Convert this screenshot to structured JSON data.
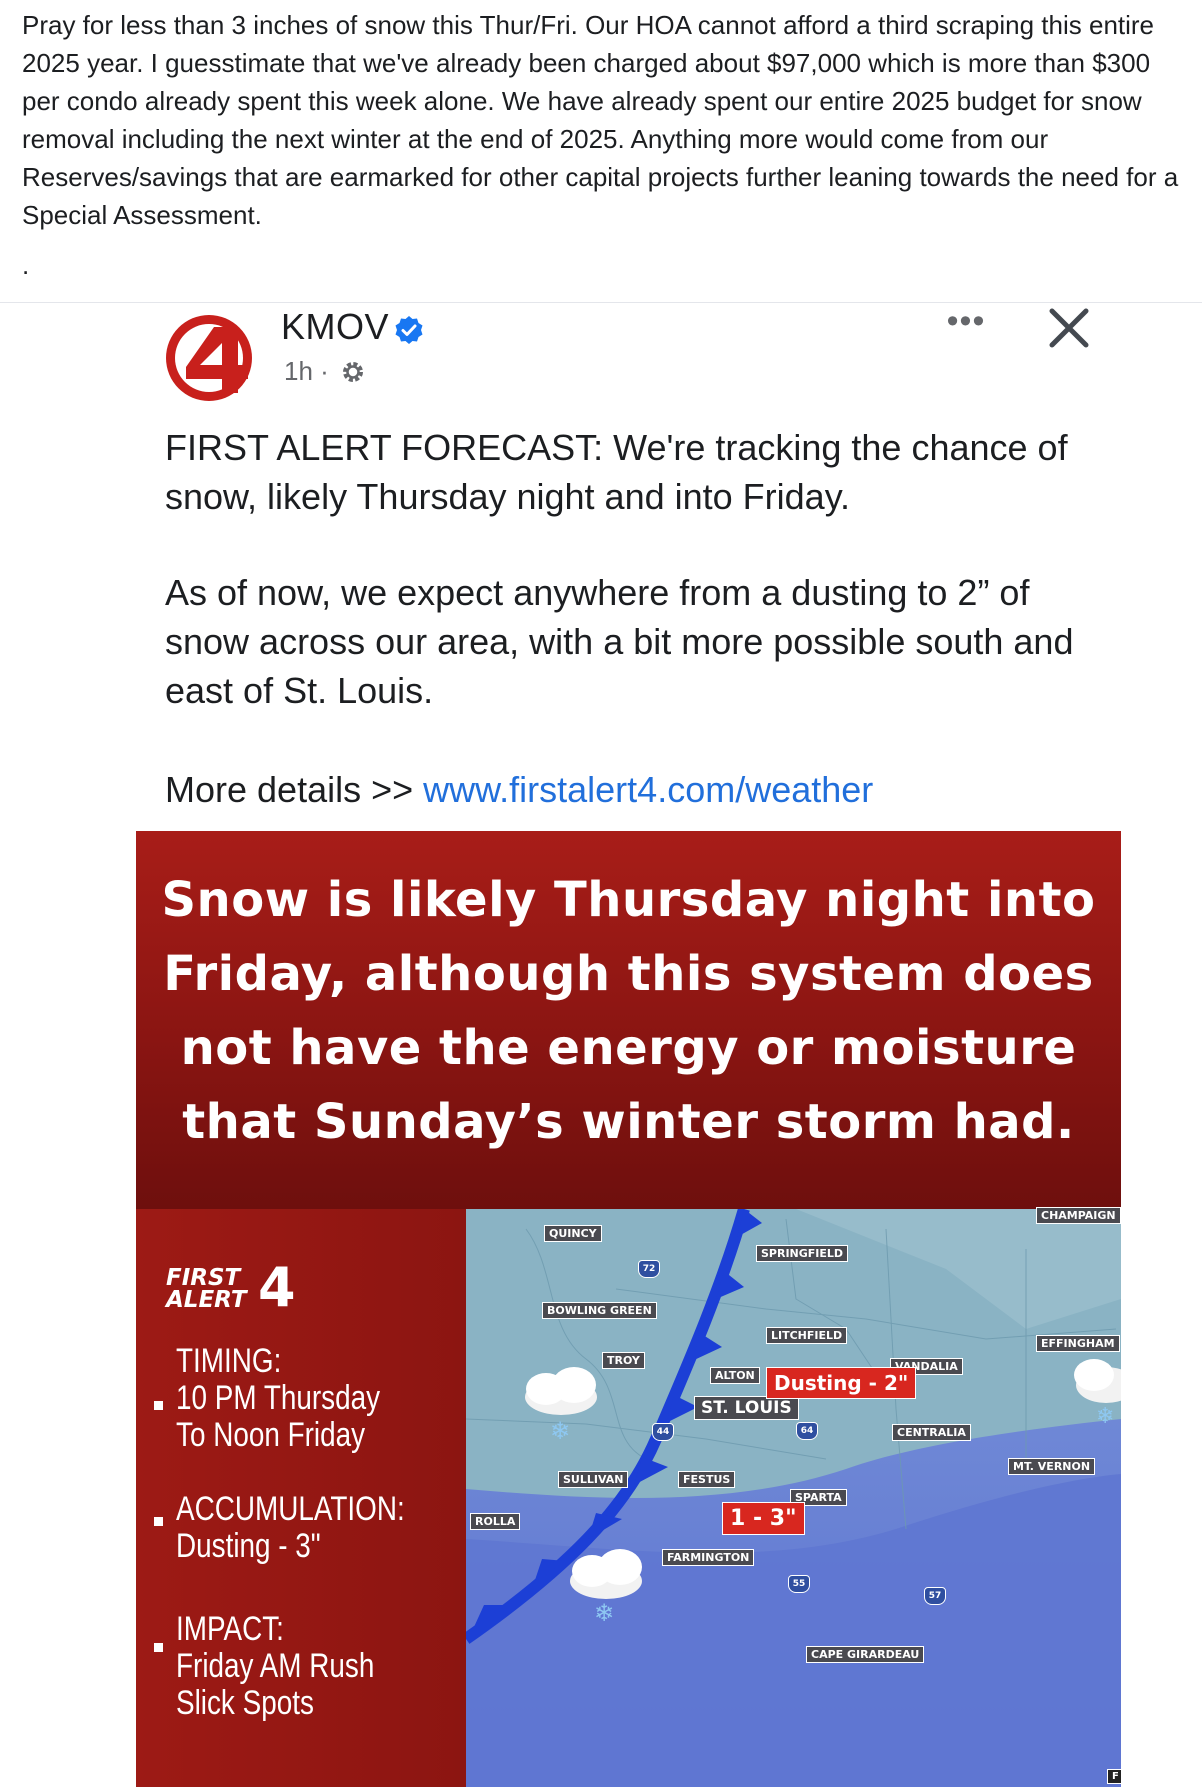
{
  "post": {
    "text": "Pray for less than 3 inches of snow this Thur/Fri. Our HOA cannot afford a third scraping this entire 2025 year. I guesstimate that we've already been charged about $97,000 which is more than $300 per condo already spent this week alone.  We have already spent our entire 2025 budget for snow removal including the next winter at the end of 2025. Anything more would come from our Reserves/savings that are earmarked for other capital projects further leaning towards the need for a Special Assessment.",
    "trailing": "."
  },
  "shared_post": {
    "page_name": "KMOV",
    "logo_text": "4",
    "time": "1h",
    "separator": "·",
    "more_label": "•••",
    "close_label": "×",
    "message_1": "FIRST ALERT FORECAST: We're tracking the chance of snow, likely Thursday night and into Friday.",
    "message_2": "As of now, we expect anywhere from a dusting to 2” of snow across our area, with a bit more possible south and east of St. Louis.",
    "more_details": "More details >> ",
    "link": "www.firstalert4.com/weather"
  },
  "graphic": {
    "headline": "Snow is likely Thursday night into Friday, although this system does not have the energy or moisture that Sunday’s winter storm had.",
    "logo_line1": "FIRST",
    "logo_line2": "ALERT",
    "logo_num": "4",
    "timing": {
      "label": "TIMING:",
      "line1": "10 PM Thursday",
      "line2": "To Noon Friday"
    },
    "accumulation": {
      "label": "ACCUMULATION:",
      "line1": "Dusting - 3\""
    },
    "impact": {
      "label": "IMPACT:",
      "line1": "Friday AM Rush",
      "line2": "Slick Spots"
    },
    "map": {
      "cities": [
        "QUINCY",
        "SPRINGFIELD",
        "CHAMPAIGN",
        "BOWLING GREEN",
        "LITCHFIELD",
        "EFFINGHAM",
        "TROY",
        "VANDALIA",
        "ALTON",
        "ST. LOUIS",
        "CENTRALIA",
        "SULLIVAN",
        "FESTUS",
        "MT. VERNON",
        "SPARTA",
        "ROLLA",
        "FARMINGTON",
        "CAPE GIRARDEAU"
      ],
      "amounts": [
        "Dusting - 2\"",
        "1 - 3\""
      ],
      "shields": [
        "72",
        "44",
        "64",
        "55",
        "57"
      ],
      "corner_mark": "F"
    }
  }
}
